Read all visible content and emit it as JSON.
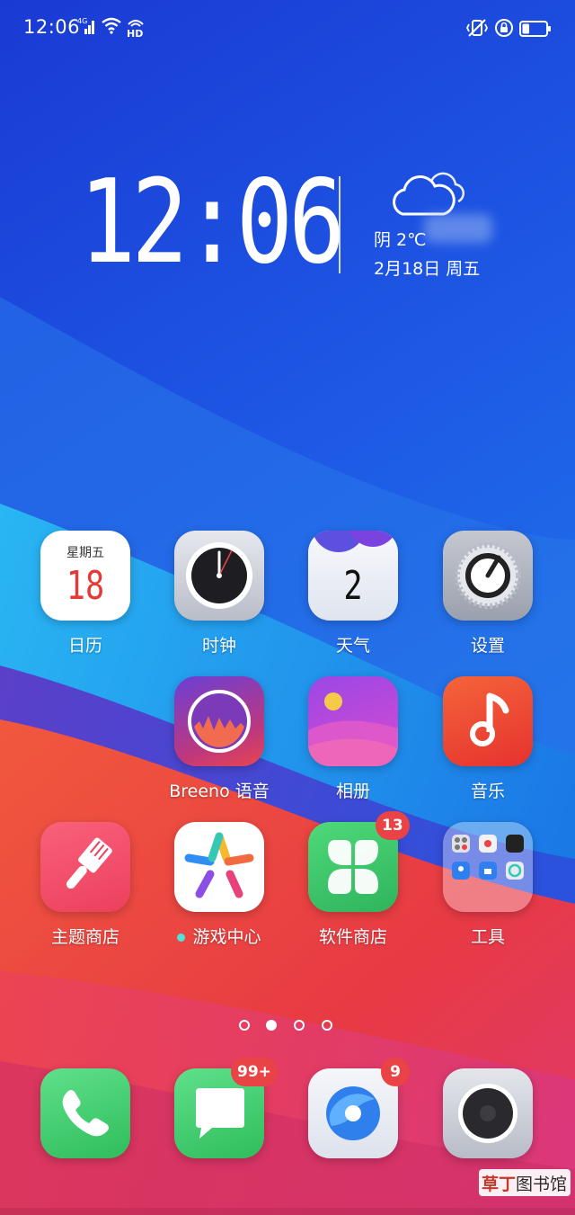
{
  "status_bar": {
    "time": "12:06",
    "network": "4G",
    "hd": "HD",
    "icons": [
      "signal-icon",
      "wifi-icon",
      "hd-call-icon",
      "vibrate-mute-icon",
      "rotation-lock-icon",
      "battery-icon"
    ],
    "battery_level": 0.3
  },
  "widget": {
    "clock": "12:06",
    "weather": "阴 2℃",
    "date": "2月18日  周五",
    "weather_icon": "cloud-icon"
  },
  "calendar_icon": {
    "weekday": "星期五",
    "day": "18"
  },
  "weather_icon_app": {
    "number": "2"
  },
  "apps": {
    "calendar": "日历",
    "clock": "时钟",
    "weather": "天气",
    "settings": "设置",
    "breeno": "Breeno 语音",
    "gallery": "相册",
    "music": "音乐",
    "themes": "主题商店",
    "game_center": "游戏中心",
    "app_store": "软件商店",
    "tools": "工具"
  },
  "badges": {
    "app_store": "13",
    "messages": "99+",
    "browser": "9"
  },
  "dock": [
    "phone-icon",
    "messages-icon",
    "browser-icon",
    "camera-icon"
  ],
  "pages": {
    "count": 4,
    "current": 2
  },
  "watermark": {
    "part1": "草丁",
    "part2": "图书馆"
  },
  "colors": {
    "wallpaper_blue": "#1f4ee0",
    "wallpaper_cyan": "#1c8ff0",
    "wallpaper_red": "#e8413a",
    "badge": "#e94345"
  }
}
